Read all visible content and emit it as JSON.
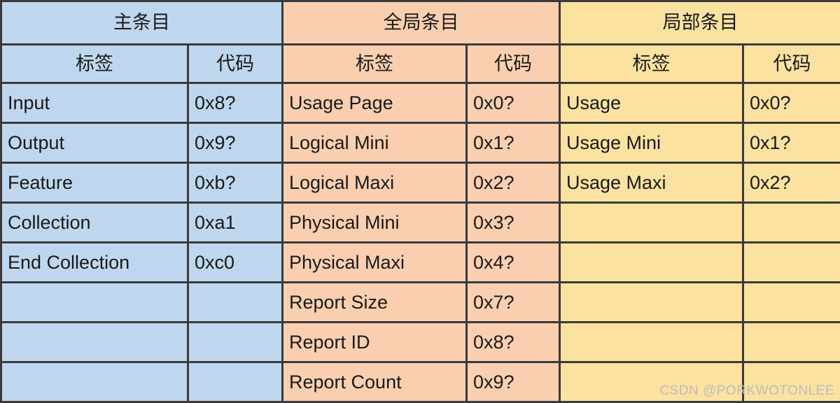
{
  "table": {
    "groups": [
      {
        "id": "main",
        "title": "主条目",
        "fill": "#bfd7ee",
        "columns": {
          "label": "标签",
          "code": "代码"
        },
        "rows": [
          {
            "label": "Input",
            "code": "0x8?"
          },
          {
            "label": "Output",
            "code": "0x9?"
          },
          {
            "label": "Feature",
            "code": "0xb?"
          },
          {
            "label": "Collection",
            "code": "0xa1"
          },
          {
            "label": "End Collection",
            "code": "0xc0"
          },
          {
            "label": "",
            "code": ""
          },
          {
            "label": "",
            "code": ""
          },
          {
            "label": "",
            "code": ""
          }
        ]
      },
      {
        "id": "global",
        "title": "全局条目",
        "fill": "#f9cfb0",
        "columns": {
          "label": "标签",
          "code": "代码"
        },
        "rows": [
          {
            "label": "Usage Page",
            "code": "0x0?"
          },
          {
            "label": "Logical Mini",
            "code": "0x1?"
          },
          {
            "label": "Logical Maxi",
            "code": "0x2?"
          },
          {
            "label": "Physical Mini",
            "code": "0x3?"
          },
          {
            "label": "Physical Maxi",
            "code": "0x4?"
          },
          {
            "label": "Report Size",
            "code": "0x7?"
          },
          {
            "label": "Report ID",
            "code": "0x8?"
          },
          {
            "label": "Report Count",
            "code": "0x9?"
          }
        ]
      },
      {
        "id": "local",
        "title": "局部条目",
        "fill": "#fbe2a0",
        "columns": {
          "label": "标签",
          "code": "代码"
        },
        "rows": [
          {
            "label": "Usage",
            "code": "0x0?"
          },
          {
            "label": "Usage Mini",
            "code": "0x1?"
          },
          {
            "label": "Usage Maxi",
            "code": "0x2?"
          },
          {
            "label": "",
            "code": ""
          },
          {
            "label": "",
            "code": ""
          },
          {
            "label": "",
            "code": ""
          },
          {
            "label": "",
            "code": ""
          },
          {
            "label": "",
            "code": ""
          }
        ]
      }
    ],
    "border_color": "#3a3a3a",
    "row_count": 8
  },
  "watermark": {
    "text": "CSDN @PORKWOTONLEE",
    "color": "#bdbdbd"
  }
}
